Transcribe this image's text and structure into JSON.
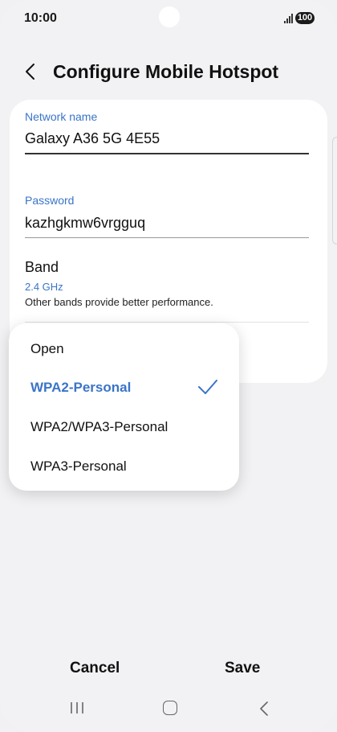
{
  "status_bar": {
    "time": "10:00",
    "battery": "100"
  },
  "header": {
    "title": "Configure Mobile Hotspot"
  },
  "form": {
    "network_name_label": "Network name",
    "network_name_value": "Galaxy A36 5G 4E55",
    "password_label": "Password",
    "password_value": "kazhgkmw6vrgguq",
    "band_title": "Band",
    "band_value": "2.4 GHz",
    "band_description": "Other bands provide better performance."
  },
  "security_dropdown": {
    "options": [
      "Open",
      "WPA2-Personal",
      "WPA2/WPA3-Personal",
      "WPA3-Personal"
    ],
    "selected": "WPA2-Personal"
  },
  "actions": {
    "cancel_label": "Cancel",
    "save_label": "Save"
  },
  "colors": {
    "accent": "#3a74c8",
    "background": "#f2f2f4",
    "card": "#ffffff"
  }
}
